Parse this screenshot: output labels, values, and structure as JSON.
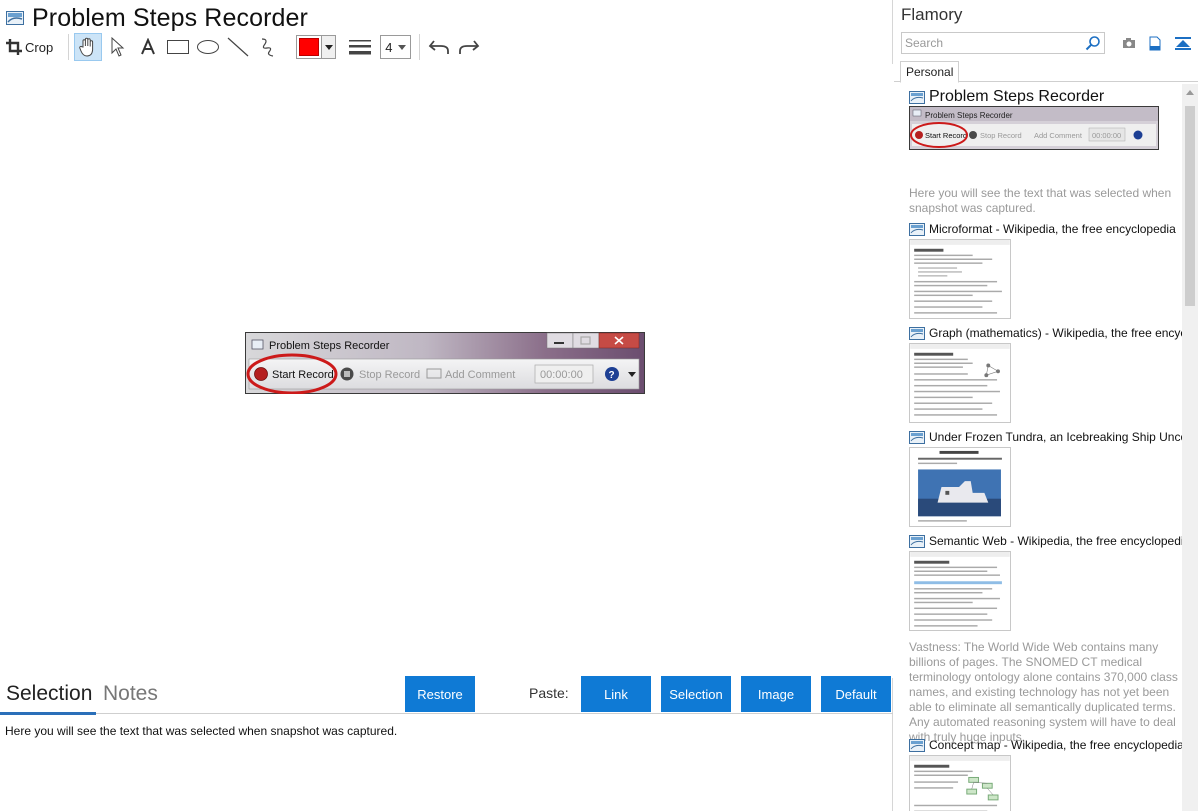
{
  "header": {
    "title": "Problem Steps Recorder"
  },
  "toolbar": {
    "crop_label": "Crop",
    "color": "#ff0000",
    "line_width": "4"
  },
  "snapshot": {
    "window_title": "Problem Steps Recorder",
    "start_record": "Start Record",
    "stop_record": "Stop Record",
    "add_comment": "Add Comment",
    "timer": "00:00:00",
    "highlight_color": "#cc1a1a"
  },
  "bottom": {
    "tab_selection": "Selection",
    "tab_notes": "Notes",
    "restore": "Restore",
    "paste_label": "Paste:",
    "paste_link": "Link",
    "paste_selection": "Selection",
    "paste_image": "Image",
    "paste_default": "Default",
    "selection_text": "Here you will see the text that was selected when snapshot was captured.",
    "accent": "#0f7ad5"
  },
  "sidebar": {
    "title": "Flamory",
    "search_placeholder": "Search",
    "tab_personal": "Personal",
    "items": [
      {
        "title": "Problem Steps Recorder",
        "note": "Here you will see the text that was selected when snapshot was captured."
      },
      {
        "title": "Microformat - Wikipedia, the free encyclopedia"
      },
      {
        "title": "Graph (mathematics) - Wikipedia, the free encyclopedia"
      },
      {
        "title": "Under Frozen Tundra, an Icebreaking Ship Uncovers Its Mission"
      },
      {
        "title": "Semantic Web - Wikipedia, the free encyclopedia",
        "note": "Vastness: The World Wide Web contains many billions of pages. The SNOMED CT medical terminology ontology alone contains 370,000 class names, and existing technology has not yet been able to eliminate all semantically duplicated terms. Any automated reasoning system will have to deal with truly huge inputs."
      },
      {
        "title": "Concept map - Wikipedia, the free encyclopedia"
      }
    ]
  }
}
